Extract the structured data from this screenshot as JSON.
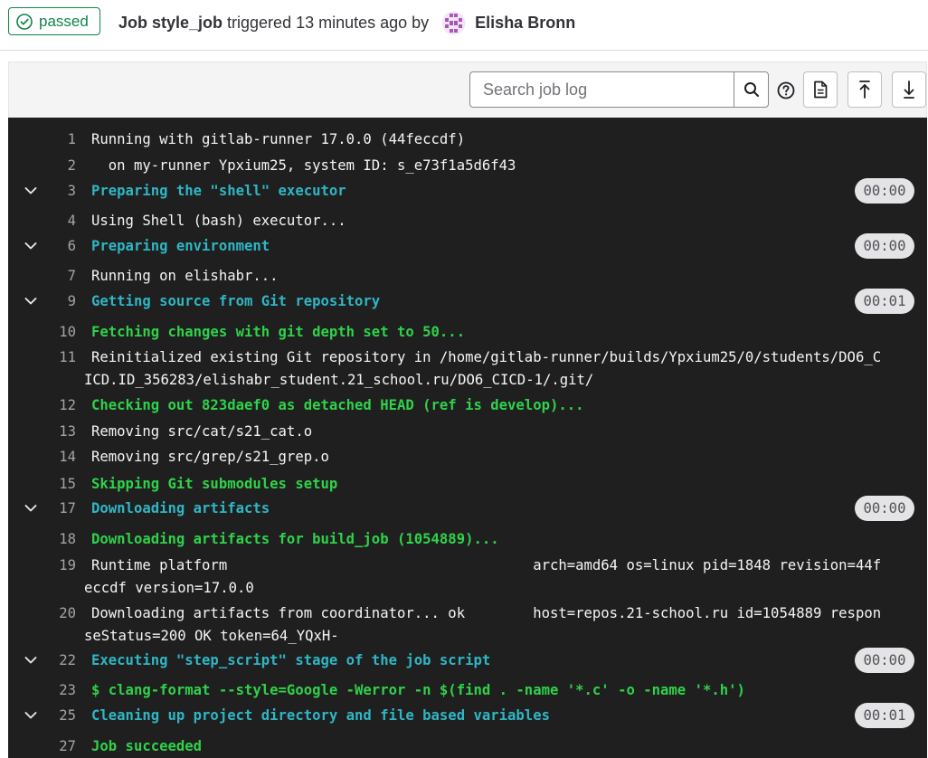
{
  "header": {
    "status_label": "passed",
    "job_label": "Job style_job",
    "trigger_text": "triggered 13 minutes ago by",
    "author_name": "Elisha Bronn"
  },
  "toolbar": {
    "search_placeholder": "Search job log"
  },
  "log": {
    "lines": [
      {
        "num": "1",
        "text": "Running with gitlab-runner 17.0.0 (44feccdf)",
        "color": "white"
      },
      {
        "num": "2",
        "text": "  on my-runner Ypxium25, system ID: s_e73f1a5d6f43",
        "color": "white"
      },
      {
        "num": "3",
        "text": "Preparing the \"shell\" executor",
        "color": "cyan",
        "section": true,
        "duration": "00:00"
      },
      {
        "num": "4",
        "text": "Using Shell (bash) executor...",
        "color": "white"
      },
      {
        "num": "6",
        "text": "Preparing environment",
        "color": "cyan",
        "section": true,
        "duration": "00:00"
      },
      {
        "num": "7",
        "text": "Running on elishabr...",
        "color": "white"
      },
      {
        "num": "9",
        "text": "Getting source from Git repository",
        "color": "cyan",
        "section": true,
        "duration": "00:01"
      },
      {
        "num": "10",
        "text": "Fetching changes with git depth set to 50...",
        "color": "green"
      },
      {
        "num": "11",
        "text": "Reinitialized existing Git repository in /home/gitlab-runner/builds/Ypxium25/0/students/DO6_C",
        "text2": "ICD.ID_356283/elishabr_student.21_school.ru/DO6_CICD-1/.git/",
        "color": "white"
      },
      {
        "num": "12",
        "text": "Checking out 823daef0 as detached HEAD (ref is develop)...",
        "color": "green"
      },
      {
        "num": "13",
        "text": "Removing src/cat/s21_cat.o",
        "color": "white"
      },
      {
        "num": "14",
        "text": "Removing src/grep/s21_grep.o",
        "color": "white"
      },
      {
        "num": "15",
        "text": "Skipping Git submodules setup",
        "color": "green"
      },
      {
        "num": "17",
        "text": "Downloading artifacts",
        "color": "cyan",
        "section": true,
        "duration": "00:00"
      },
      {
        "num": "18",
        "text": "Downloading artifacts for build_job (1054889)...",
        "color": "green"
      },
      {
        "num": "19",
        "text": "Runtime platform                                    arch=amd64 os=linux pid=1848 revision=44f",
        "text2": "eccdf version=17.0.0",
        "color": "white"
      },
      {
        "num": "20",
        "text": "Downloading artifacts from coordinator... ok        host=repos.21-school.ru id=1054889 respon",
        "text2": "seStatus=200 OK token=64_YQxH-",
        "color": "white"
      },
      {
        "num": "22",
        "text": "Executing \"step_script\" stage of the job script",
        "color": "cyan",
        "section": true,
        "duration": "00:00"
      },
      {
        "num": "23",
        "text": "$ clang-format --style=Google -Werror -n $(find . -name '*.c' -o -name '*.h')",
        "color": "green"
      },
      {
        "num": "25",
        "text": "Cleaning up project directory and file based variables",
        "color": "cyan",
        "section": true,
        "duration": "00:01"
      },
      {
        "num": "27",
        "text": "Job succeeded",
        "color": "green"
      }
    ]
  }
}
